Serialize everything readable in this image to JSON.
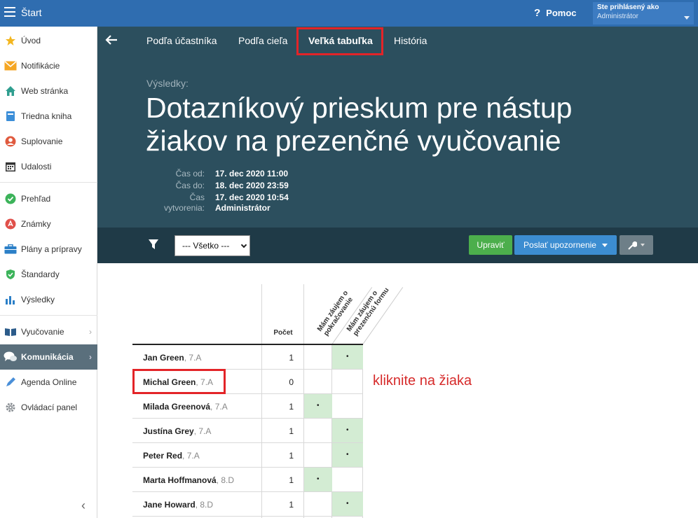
{
  "app": {
    "title": "Štart"
  },
  "topbar": {
    "help_label": "Pomoc",
    "logged_in_label": "Ste prihlásený ako",
    "user": "Administrátor"
  },
  "sidebar": {
    "items": [
      {
        "label": "Úvod",
        "icon": "star-icon"
      },
      {
        "label": "Notifikácie",
        "icon": "envelope-icon"
      },
      {
        "label": "Web stránka",
        "icon": "home-icon"
      },
      {
        "label": "Triedna kniha",
        "icon": "book-icon"
      },
      {
        "label": "Suplovanie",
        "icon": "person-icon"
      },
      {
        "label": "Udalosti",
        "icon": "calendar-icon"
      },
      {
        "label": "Prehľad",
        "icon": "check-circle-icon"
      },
      {
        "label": "Známky",
        "icon": "grades-icon"
      },
      {
        "label": "Plány a prípravy",
        "icon": "briefcase-icon"
      },
      {
        "label": "Štandardy",
        "icon": "shield-check-icon"
      },
      {
        "label": "Výsledky",
        "icon": "bar-chart-icon"
      },
      {
        "label": "Vyučovanie",
        "icon": "open-book-icon"
      },
      {
        "label": "Komunikácia",
        "icon": "chat-icon"
      },
      {
        "label": "Agenda Online",
        "icon": "pen-icon"
      },
      {
        "label": "Ovládací panel",
        "icon": "gear-icon"
      }
    ]
  },
  "tabs": [
    {
      "label": "Podľa účastníka"
    },
    {
      "label": "Podľa cieľa"
    },
    {
      "label": "Veľká tabuľka"
    },
    {
      "label": "História"
    }
  ],
  "page": {
    "results_label": "Výsledky:",
    "title": "Dotazníkový prieskum pre nástup žiakov na prezenčné vyučovanie",
    "meta": [
      {
        "key": "Čas od:",
        "value": "17. dec 2020 11:00"
      },
      {
        "key": "Čas do:",
        "value": "18. dec 2020 23:59"
      },
      {
        "key": "Čas",
        "key2": "vytvorenia:",
        "value": "17. dec 2020 10:54",
        "value2": "Administrátor"
      }
    ]
  },
  "toolbar": {
    "filter_value": "--- Všetko ---",
    "edit_label": "Upraviť",
    "notify_label": "Poslať upozornenie"
  },
  "table": {
    "count_header": "Počet",
    "columns": [
      {
        "line1": "Mám záujem o",
        "line2": "pokračovanie"
      },
      {
        "line1": "Mám záujem o",
        "line2": "prezenčnú formu"
      }
    ],
    "rows": [
      {
        "name": "Jan Green",
        "class": ", 7.A",
        "count": "1",
        "marks": [
          "",
          "•"
        ]
      },
      {
        "name": "Michal Green",
        "class": ", 7.A",
        "count": "0",
        "marks": [
          "",
          ""
        ]
      },
      {
        "name": "Milada Greenová",
        "class": ", 7.A",
        "count": "1",
        "marks": [
          "•",
          ""
        ]
      },
      {
        "name": "Justína Grey",
        "class": ", 7.A",
        "count": "1",
        "marks": [
          "",
          "•"
        ]
      },
      {
        "name": "Peter Red",
        "class": ", 7.A",
        "count": "1",
        "marks": [
          "",
          "•"
        ]
      },
      {
        "name": "Marta Hoffmanová",
        "class": ", 8.D",
        "count": "1",
        "marks": [
          "•",
          ""
        ]
      },
      {
        "name": "Jane Howard",
        "class": ", 8.D",
        "count": "1",
        "marks": [
          "",
          "•"
        ]
      }
    ]
  },
  "annotation": "kliknite na žiaka",
  "colors": {
    "topbar": "#2f6db0",
    "header": "#2c4f5e",
    "toolbar": "#1f3a47",
    "highlight": "#e32428",
    "cell_fill": "#d3ecd3"
  }
}
